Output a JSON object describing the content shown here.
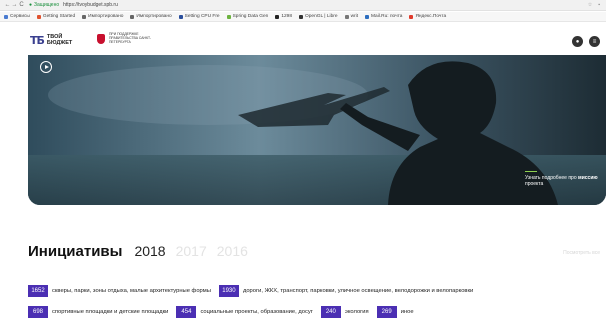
{
  "browser": {
    "secure_label": "Защищено",
    "url": "https://tvoybudget.spb.ru",
    "bookmarks": [
      {
        "label": "Сервисы",
        "color": "#4a7bd0"
      },
      {
        "label": "Getting Started",
        "color": "#e0522f"
      },
      {
        "label": "Импортировано",
        "color": "#666666"
      },
      {
        "label": "Импортировано",
        "color": "#666666"
      },
      {
        "label": "Setting CPU Fre",
        "color": "#2b4f9c"
      },
      {
        "label": "Spring Data Gen",
        "color": "#6db33f"
      },
      {
        "label": "1298",
        "color": "#222222"
      },
      {
        "label": "OpenGL | Libre",
        "color": "#333333"
      },
      {
        "label": "writ",
        "color": "#777777"
      },
      {
        "label": "Mail.Ru: почта",
        "color": "#2d6ebf"
      },
      {
        "label": "Яндекс.Почта",
        "color": "#e03b2c"
      }
    ]
  },
  "header": {
    "logo_mark": "ТБ",
    "logo_text": "ТВОЙ БЮДЖЕТ",
    "gov_text": "ПРИ ПОДДЕРЖКЕ ПРАВИТЕЛЬСТВА САНКТ-ПЕТЕРБУРГА"
  },
  "hero": {
    "mission_prefix": "Узнать подробнее про",
    "mission_bold": "миссию",
    "mission_suffix": "проекта"
  },
  "initiatives": {
    "title": "Инициативы",
    "years": [
      "2018",
      "2017",
      "2016"
    ],
    "active_year": "2018",
    "show_all": "Посмотреть все",
    "rows": [
      [
        {
          "count": "1652",
          "label": "скверы, парки, зоны отдыха, малые архитектурные формы"
        },
        {
          "count": "1930",
          "label": "дороги, ЖКХ, транспорт, парковки, уличное освещение, велодорожки и велопарковки"
        }
      ],
      [
        {
          "count": "698",
          "label": "спортивные площадки и детские площадки"
        },
        {
          "count": "454",
          "label": "социальные проекты, образование, досуг"
        },
        {
          "count": "240",
          "label": "экология"
        },
        {
          "count": "269",
          "label": "иное"
        }
      ]
    ]
  },
  "colors": {
    "accent": "#4b2fb3",
    "mission_line": "#8fd14f"
  }
}
